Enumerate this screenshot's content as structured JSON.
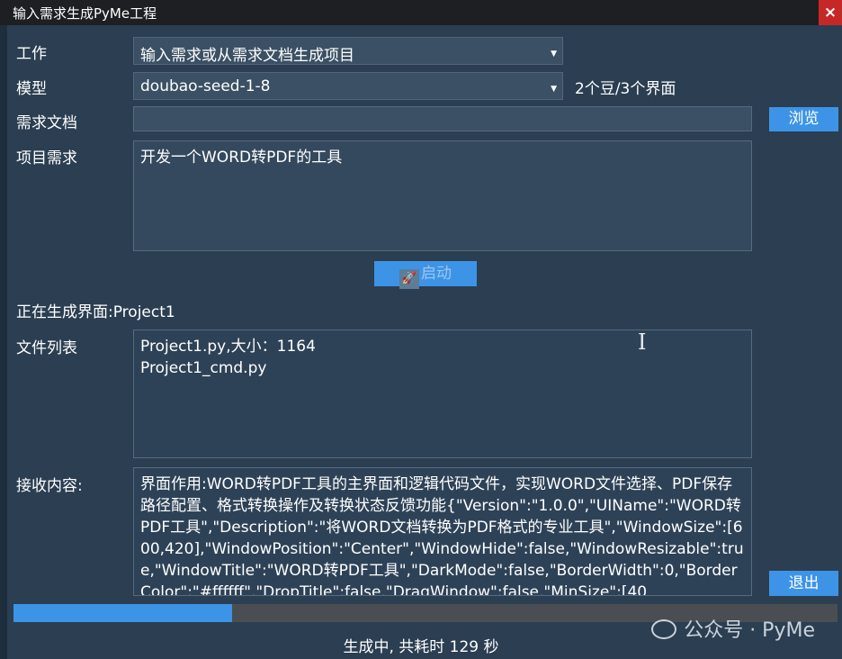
{
  "window": {
    "title": "输入需求生成PyMe工程",
    "close_glyph": "×"
  },
  "form": {
    "work_label": "工作",
    "work_value": "输入需求或从需求文档生成项目",
    "model_label": "模型",
    "model_value": "doubao-seed-1-8",
    "model_cost": "2个豆/3个界面",
    "doc_label": "需求文档",
    "doc_value": "",
    "browse_label": "浏览",
    "req_label": "项目需求",
    "req_value": "开发一个WORD转PDF的工具",
    "start_label": "启动",
    "start_icon": "rocket-icon"
  },
  "generation": {
    "status_line": "正在生成界面:Project1",
    "files_label": "文件列表",
    "files": [
      "Project1.py,大小：1164",
      "Project1_cmd.py"
    ],
    "received_label": "接收内容:",
    "received_text": "界面作用:WORD转PDF工具的主界面和逻辑代码文件，实现WORD文件选择、PDF保存路径配置、格式转换操作及转换状态反馈功能{\"Version\":\"1.0.0\",\"UIName\":\"WORD转PDF工具\",\"Description\":\"将WORD文档转换为PDF格式的专业工具\",\"WindowSize\":[600,420],\"WindowPosition\":\"Center\",\"WindowHide\":false,\"WindowResizable\":true,\"WindowTitle\":\"WORD转PDF工具\",\"DarkMode\":false,\"BorderWidth\":0,\"BorderColor\":\"#ffffff\",\"DropTitle\":false,\"DragWindow\":false,\"MinSize\":[40"
  },
  "footer": {
    "exit_label": "退出",
    "progress_fraction": 0.265,
    "status_text": "生成中, 共耗时 129 秒"
  },
  "watermark": {
    "text": "公众号 · PyMe",
    "icon": "wechat-icon"
  },
  "colors": {
    "background": "#2b3e52",
    "accent": "#3d94e6",
    "close": "#c62828"
  }
}
